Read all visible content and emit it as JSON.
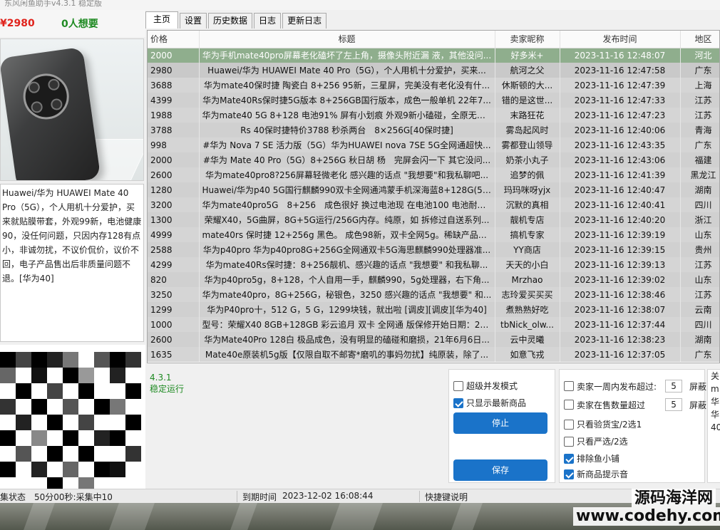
{
  "window": {
    "title": "东风闲鱼助手v4.3.1 稳定版"
  },
  "left": {
    "price": "¥2980",
    "wants": "0人想要",
    "description": "Huawei/华为 HUAWEI Mate 40 Pro（5G），个人用机十分爱护，买来就贴膜带套，外观99新，电池健康90，没任何问题，只因内存128有点小，非诚勿扰，不议价侃价，议价不回，电子产品售出后非质量问题不退。[华为40]"
  },
  "tabs": [
    "主页",
    "设置",
    "历史数据",
    "日志",
    "更新日志"
  ],
  "table": {
    "headers": {
      "price": "价格",
      "title": "标题",
      "seller": "卖家昵称",
      "time": "发布时间",
      "region": "地区"
    },
    "rows": [
      {
        "price": "2000",
        "title": "华为手机mate40pro屏幕老化磕坏了左上角，摄像头附近漏 液，其他没问...",
        "seller": "好多米+",
        "time": "2023-11-16 12:48:07",
        "region": "河北"
      },
      {
        "price": "2980",
        "title": "Huawei/华为 HUAWEI Mate 40 Pro（5G），个人用机十分爱护，买来...",
        "seller": "航河之父",
        "time": "2023-11-16 12:47:58",
        "region": "广东"
      },
      {
        "price": "3688",
        "title": "华为mate40保时捷 陶瓷白 8+256 95新，三星屏，完美没有老化没有什...",
        "seller": "休斯顿的大...",
        "time": "2023-11-16 12:47:39",
        "region": "上海"
      },
      {
        "price": "4399",
        "title": "华为Mate40Rs保时捷5G版本 8+256GB国行版本，成色一般单机 22年7...",
        "seller": "错的是这世...",
        "time": "2023-11-16 12:47:33",
        "region": "江苏"
      },
      {
        "price": "1988",
        "title": "华为mate40 5G 8+128 电池91% 屏有小划痕 外观9新小磕碰，全原无拆...",
        "seller": "末路狂花",
        "time": "2023-11-16 12:47:23",
        "region": "江苏"
      },
      {
        "price": "3788",
        "title": "Rs 40保时捷特价3788 秒杀两台　8×256G[40保时捷]",
        "seller": "雾岛起风时",
        "time": "2023-11-16 12:40:06",
        "region": "青海"
      },
      {
        "price": "998",
        "title": "#华为 Nova 7 SE 活力版（5G）华为HUAWEI nova 7SE 5G全网通超快...",
        "seller": "雾都登山领导",
        "time": "2023-11-16 12:43:35",
        "region": "广东"
      },
      {
        "price": "2000",
        "title": "#华为 Mate 40 Pro（5G）8+256G 秋日胡 杨　完屏会闪一下 其它没问...",
        "seller": "奶茶小丸子",
        "time": "2023-11-16 12:43:06",
        "region": "福建"
      },
      {
        "price": "2600",
        "title": "华为mate40pro8?256屏幕轻微老化 感兴趣的话点 \"我想要\"和我私聊吧...",
        "seller": "追梦的佩",
        "time": "2023-11-16 12:41:39",
        "region": "黑龙江"
      },
      {
        "price": "1280",
        "title": "Huawei/华为p40 5G国行麒麟990双卡全网通鸿蒙手机深海蓝8+128G(5G...",
        "seller": "玛玛咪呀yjx",
        "time": "2023-11-16 12:40:47",
        "region": "湖南"
      },
      {
        "price": "3200",
        "title": "华为mate40pro5G　8+256　成色很好 换过电池现 在电池100 电池耐用爱晚...",
        "seller": "沉默的真相",
        "time": "2023-11-16 12:40:41",
        "region": "四川"
      },
      {
        "price": "1300",
        "title": "荣耀X40，5G曲屏，8G+5G运行/256G内存。纯原，如 拆修过自送系列...",
        "seller": "靓机专店",
        "time": "2023-11-16 12:40:20",
        "region": "浙江"
      },
      {
        "price": "4999",
        "title": "mate40rs 保时捷 12+256g 黑色。 成色98新，双卡全网5g。稀缺产品，...",
        "seller": "搞机专家",
        "time": "2023-11-16 12:39:19",
        "region": "山东"
      },
      {
        "price": "2588",
        "title": "华为p40pro 华为p40pro8G+256G全网通双卡5G海思麒麟990处理器准...",
        "seller": "YY商店",
        "time": "2023-11-16 12:39:15",
        "region": "贵州"
      },
      {
        "price": "4299",
        "title": "华为mate40Rs保时捷：8+256靓机、感兴趣的话点 \"我想要\" 和我私聊...",
        "seller": "天天的小白",
        "time": "2023-11-16 12:39:13",
        "region": "江苏"
      },
      {
        "price": "820",
        "title": "华为p40pro5g，8+128，个人自用一手，麒麟990，5g处理器，右下角...",
        "seller": "Mrzhao",
        "time": "2023-11-16 12:39:02",
        "region": "山东"
      },
      {
        "price": "3250",
        "title": "华为mate40pro，8G+256G，秘银色，3250 感兴趣的话点 \"我想要\" 和...",
        "seller": "志玲爱买买买",
        "time": "2023-11-16 12:38:46",
        "region": "江苏"
      },
      {
        "price": "1299",
        "title": "华为P40pro十，512 G，5 G，1299块钱，就出啦 [调皮][调皮][华为40]",
        "seller": "煮熟熟好吃",
        "time": "2023-11-16 12:38:07",
        "region": "云南"
      },
      {
        "price": "1000",
        "title": "型号：荣耀X40 8GB+128GB 彩云追月 双卡 全网通 版保修开始日期：20...",
        "seller": "tbNick_olw...",
        "time": "2023-11-16 12:37:44",
        "region": "四川"
      },
      {
        "price": "2600",
        "title": "华为Mate40Pro 128白 极品成色，没有明显的磕碰和磨损，21年6月6日...",
        "seller": "云中灵曦",
        "time": "2023-11-16 12:38:23",
        "region": "湖南"
      },
      {
        "price": "1635",
        "title": "Mate40e原装机5g版【仅限自取不邮寄*磨叽的事妈勿扰】纯原装，除了...",
        "seller": "如意飞戎",
        "time": "2023-11-16 12:37:05",
        "region": "广东"
      }
    ]
  },
  "bottom": {
    "version": "4.3.1",
    "version_status": "稳定运行",
    "opt_concurrent": "超级并发模式",
    "opt_latest": "只显示最新商品",
    "btn_stop": "停止",
    "btn_save": "保存",
    "opt_week_label": "卖家一周内发布超过:",
    "opt_week_value": "5",
    "opt_week_unit": "屏蔽",
    "opt_onsale_label": "卖家在售数量超过",
    "opt_onsale_value": "5",
    "opt_onsale_unit": "屏蔽",
    "opt_inspect": "只看验货宝/2选1",
    "opt_strict": "只看严选/2选",
    "opt_exclude_shop": "排除鱼小铺",
    "opt_sound": "新商品提示音",
    "side_partial": "关\nm\n华\n华\n40"
  },
  "status": {
    "collect": "集状态　50分00秒:采集中10",
    "expire_label": "到期时间",
    "expire_value": "2023-12-02 16:08:44",
    "shortcut": "快捷键说明"
  },
  "watermark": {
    "line1": "源码海洋网",
    "line2": "www.codehy.com"
  },
  "colors": {
    "accent": "#1a73c9",
    "price_red": "#e0231c",
    "green": "#1e8a22",
    "selected_row": "#8fae8d"
  }
}
